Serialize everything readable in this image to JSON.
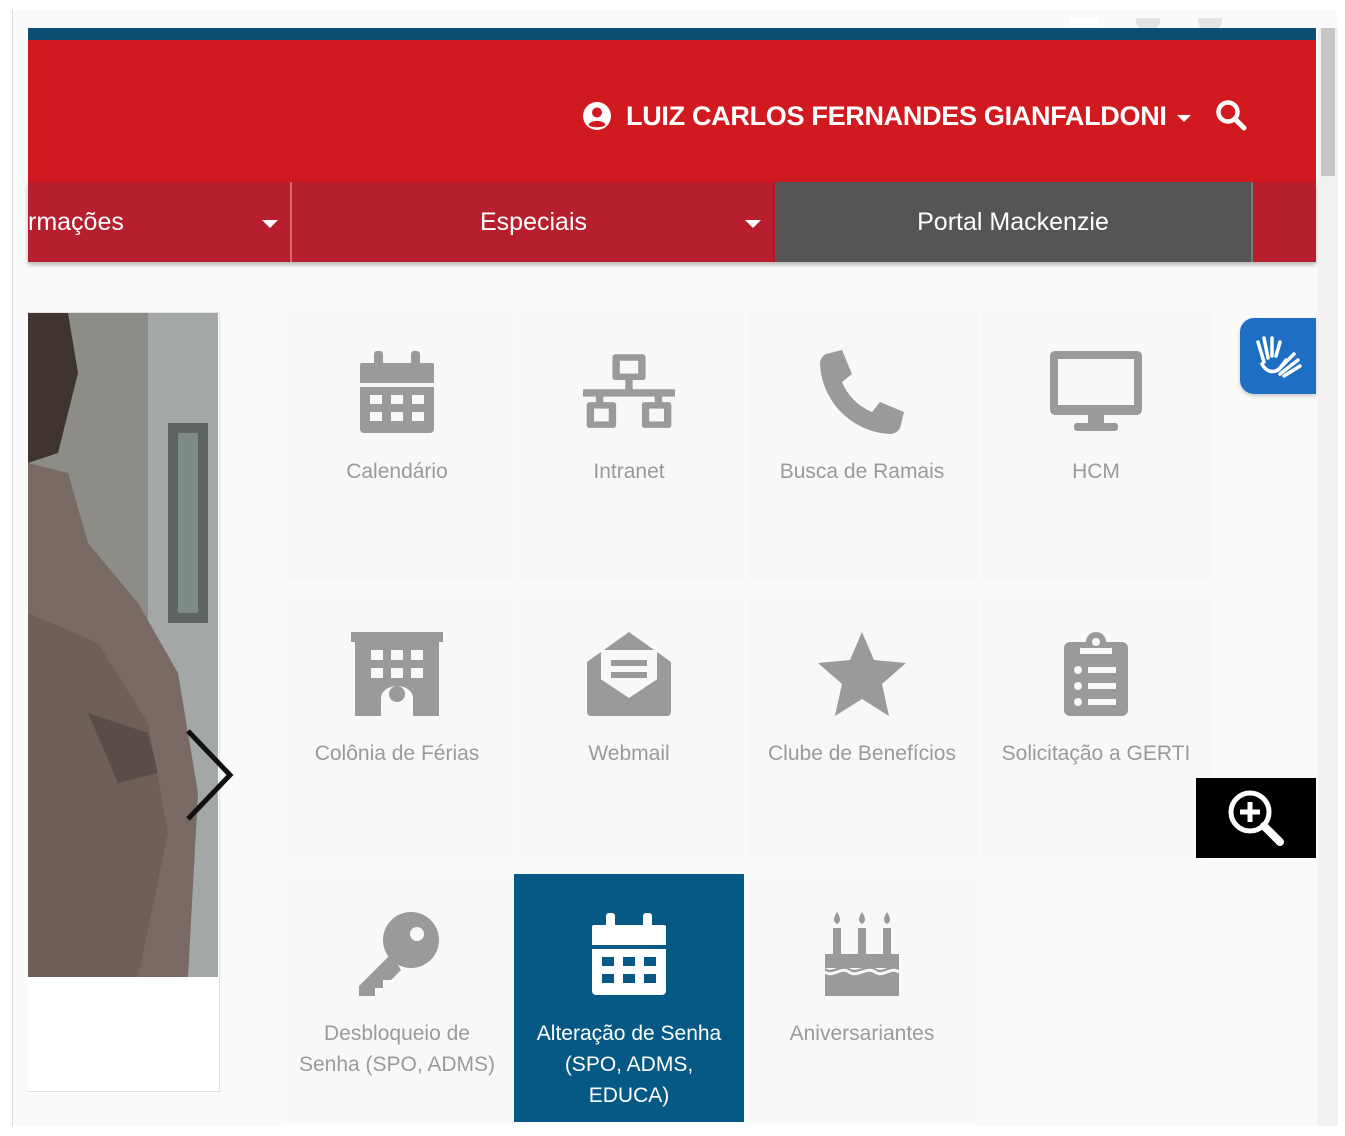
{
  "header": {
    "user_name": "LUIZ CARLOS FERNANDES GIANFALDONI",
    "user_icon": "user-circle-icon",
    "search_icon": "search-icon",
    "brand_color": "#d01a20",
    "strip_color": "#0b4f74"
  },
  "nav": {
    "items": [
      {
        "label": "rmações",
        "has_dropdown": true
      },
      {
        "label": "Especiais",
        "has_dropdown": true
      },
      {
        "label": "Portal Mackenzie",
        "has_dropdown": false
      }
    ],
    "bar_color": "#b71f2e",
    "active_color": "#555555"
  },
  "tiles": [
    {
      "label": "Calendário",
      "icon": "calendar-icon"
    },
    {
      "label": "Intranet",
      "icon": "network-icon"
    },
    {
      "label": "Busca de Ramais",
      "icon": "phone-icon"
    },
    {
      "label": "HCM",
      "icon": "desktop-icon"
    },
    {
      "label": "Colônia de Férias",
      "icon": "building-icon"
    },
    {
      "label": "Webmail",
      "icon": "envelope-open-icon"
    },
    {
      "label": "Clube de Benefícios",
      "icon": "star-icon"
    },
    {
      "label": "Solicitação a GERTI",
      "icon": "clipboard-list-icon"
    },
    {
      "label": "Desbloqueio de Senha (SPO, ADMS)",
      "icon": "key-icon"
    },
    {
      "label": "Alteração de Senha (SPO, ADMS, EDUCA)",
      "icon": "calendar-icon",
      "active": true
    },
    {
      "label": "Aniversariantes",
      "icon": "birthday-cake-icon"
    }
  ],
  "colors": {
    "tile_icon": "#9a9a9a",
    "tile_active_bg": "#075985",
    "accessibility_blue": "#1d6fc4"
  },
  "widgets": {
    "vlibras_icon": "sign-language-hands-icon",
    "zoom_icon": "zoom-in-icon",
    "carousel_next_icon": "chevron-right-icon"
  }
}
